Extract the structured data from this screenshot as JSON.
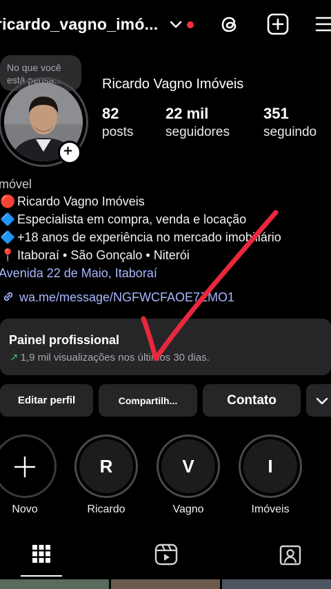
{
  "header": {
    "username": "ricardo_vagno_imó...",
    "icons": [
      "chevron-down-icon",
      "threads-icon",
      "create-icon",
      "menu-icon"
    ],
    "notification_color": "#ff2d3f"
  },
  "note": {
    "text": "No que você está pensa..."
  },
  "profile": {
    "display_name": "Ricardo Vagno Imóveis",
    "stats": [
      {
        "value": "82",
        "label": "posts"
      },
      {
        "value": "22 mil",
        "label": "seguidores"
      },
      {
        "value": "351",
        "label": "seguindo"
      }
    ]
  },
  "bio": {
    "category": "móvel",
    "lines": [
      {
        "emoji": "🔴",
        "text": "Ricardo Vagno Imóveis"
      },
      {
        "emoji": "🔷",
        "text": "Especialista em compra, venda e locação"
      },
      {
        "emoji": "🔷",
        "text": "+18 anos de experiência no mercado imobiliário"
      },
      {
        "emoji": "📍",
        "text": "Itaboraí • São Gonçalo • Niterói"
      }
    ],
    "location": "Avenida 22 de Maio, Itaboraí",
    "link": "wa.me/message/NGFWCFAOE7ZMO1"
  },
  "professional_panel": {
    "title": "Painel profissional",
    "subtitle": "1,9 mil visualizações nos últimos 30 dias."
  },
  "buttons": {
    "edit": "Editar perfil",
    "share": "Compartilh...",
    "contact": "Contato"
  },
  "highlights": [
    {
      "letter": "",
      "label": "Novo"
    },
    {
      "letter": "R",
      "label": "Ricardo"
    },
    {
      "letter": "V",
      "label": "Vagno"
    },
    {
      "letter": "I",
      "label": "Imóveis"
    }
  ],
  "colors": {
    "accent_link": "#a9b7ff",
    "panel_bg": "#262628",
    "growth": "#3ec46d"
  }
}
